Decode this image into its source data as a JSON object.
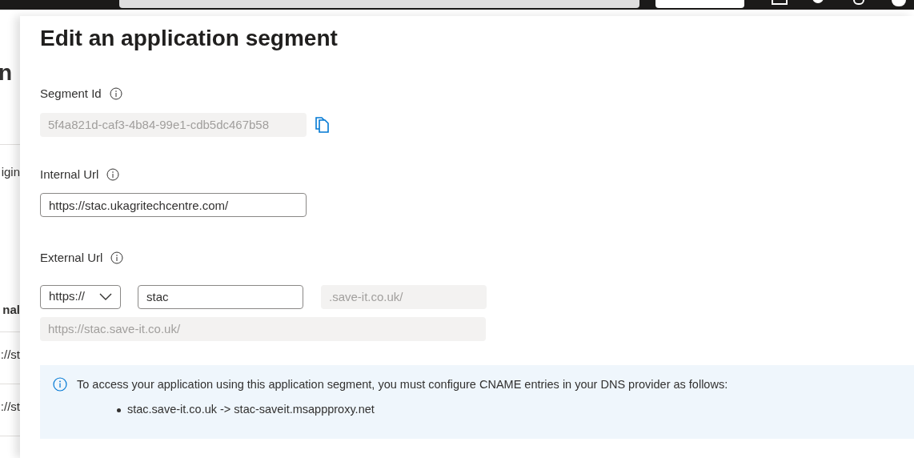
{
  "background_page": {
    "heading": "n",
    "column_fragments": [
      "igin",
      "nal"
    ],
    "row_fragments": [
      "://st",
      "://st"
    ]
  },
  "panel": {
    "title": "Edit an application segment",
    "segment_id": {
      "label": "Segment Id",
      "value": "5f4a821d-caf3-4b84-99e1-cdb5dc467b58",
      "disabled": true
    },
    "internal_url": {
      "label": "Internal Url",
      "value": "https://stac.ukagritechcentre.com/"
    },
    "external_url": {
      "label": "External Url",
      "scheme": "https://",
      "subdomain": "stac",
      "domain_suffix": ".save-it.co.uk/",
      "full_url": "https://stac.save-it.co.uk/"
    },
    "info": {
      "message": "To access your application using this application segment, you must configure CNAME entries in your DNS provider as follows:",
      "entries": [
        "stac.save-it.co.uk -> stac-saveit.msappproxy.net"
      ]
    }
  }
}
